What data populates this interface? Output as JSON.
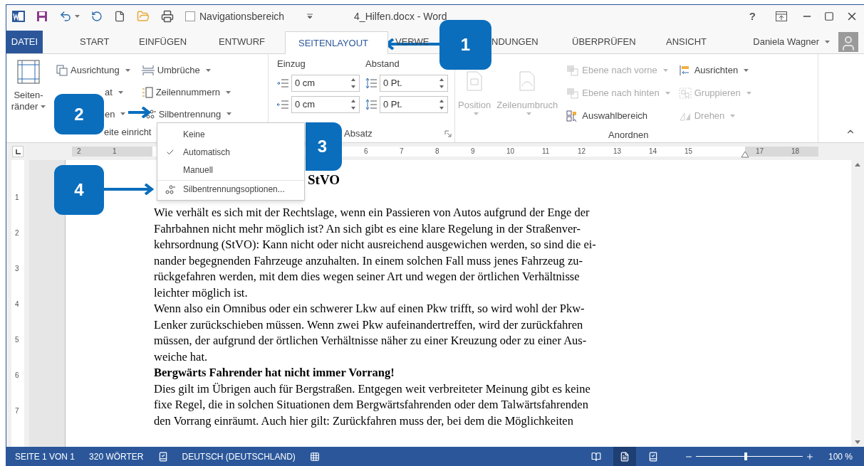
{
  "title_bar": {
    "nav_checkbox": {
      "label": "Navigationsbereich",
      "checked": false
    },
    "title": "4_Hilfen.docx - Word",
    "help": "?"
  },
  "tabs": [
    {
      "label": "DATEI",
      "kind": "file",
      "selected": false
    },
    {
      "label": "START",
      "kind": "tab",
      "selected": false
    },
    {
      "label": "EINFÜGEN",
      "kind": "tab",
      "selected": false
    },
    {
      "label": "ENTWURF",
      "kind": "tab",
      "selected": false
    },
    {
      "label": "SEITENLAYOUT",
      "kind": "tab",
      "selected": true
    },
    {
      "label": "VERWE",
      "kind": "tab",
      "selected": false
    },
    {
      "label": "NDUNGEN",
      "kind": "tab",
      "selected": false
    },
    {
      "label": "ÜBERPRÜFEN",
      "kind": "tab",
      "selected": false
    },
    {
      "label": "ANSICHT",
      "kind": "tab",
      "selected": false
    }
  ],
  "user": {
    "name": "Daniela Wagner"
  },
  "page_setup": {
    "label": "eite einricht",
    "margins": [
      "Seiten-",
      "ränder"
    ],
    "commands": [
      {
        "label": "Ausrichtung"
      },
      {
        "label": "at"
      },
      {
        "label": "en"
      },
      {
        "label": "Umbrüche"
      },
      {
        "label": "Zeilennummern"
      },
      {
        "label": "Silbentrennung"
      }
    ]
  },
  "paragraph": {
    "label": "Absatz",
    "indent": "Einzug",
    "spacing": "Abstand",
    "indent_fields": [
      {
        "value": "0 cm"
      },
      {
        "value": "0 cm"
      }
    ],
    "spacing_fields": [
      {
        "value": "0 Pt."
      },
      {
        "value": "0 Pt."
      }
    ]
  },
  "arrange": {
    "label": "Anordnen",
    "large": [
      {
        "label": "Position",
        "disabled": true
      },
      {
        "label": "Zeilenumbruch",
        "disabled": true
      }
    ],
    "commands": [
      {
        "label": "Ebene nach vorne",
        "disabled": true
      },
      {
        "label": "Ebene nach hinten",
        "disabled": true
      },
      {
        "label": "Auswahlbereich",
        "disabled": false
      },
      {
        "label": "Ausrichten",
        "disabled": false
      },
      {
        "label": "Gruppieren",
        "disabled": true
      },
      {
        "label": "Drehen",
        "disabled": true
      }
    ]
  },
  "ruler": {
    "numbers": [
      "2",
      "1",
      "6",
      "7",
      "8",
      "9",
      "10",
      "11",
      "12",
      "13",
      "14",
      "15",
      "17",
      "18"
    ],
    "vertical_numbers": [
      "1",
      "2",
      "3",
      "4",
      "5",
      "6",
      "7"
    ]
  },
  "hyphenation_menu": {
    "items": [
      {
        "label": "Keine",
        "kind": "choice",
        "checked": false
      },
      {
        "label": "Automatisch",
        "kind": "choice",
        "checked": true
      },
      {
        "label": "Manuell",
        "kind": "choice",
        "checked": false
      },
      {
        "label": "Silbentrennungsoptionen...",
        "kind": "dialog",
        "checked": false
      }
    ]
  },
  "document": {
    "heading_fragment": "StVO",
    "lines": [
      {
        "text": "Wie verhält es sich mit der Rechtslage, wenn ein Passieren von Autos aufgrund der Enge der",
        "kind": "normal"
      },
      {
        "text": "Fahrbahnen nicht mehr möglich ist? An sich gibt es eine klare Regelung in der Straßenver-",
        "kind": "normal"
      },
      {
        "text": "kehrsordnung (StVO): Kann nicht oder nicht ausreichend ausgewichen werden, so sind die ei-",
        "kind": "normal"
      },
      {
        "text": "nander begegnenden Fahrzeuge anzuhalten. In einem solchen Fall muss jenes Fahrzeug zu-",
        "kind": "normal"
      },
      {
        "text": "rückgefahren werden, mit dem dies wegen seiner Art und wegen der örtlichen Verhältnisse",
        "kind": "normal"
      },
      {
        "text": "leichter möglich ist.",
        "kind": "normal"
      },
      {
        "text": "Wenn also ein Omnibus oder ein schwerer Lkw auf einen Pkw trifft, so wird wohl der Pkw-",
        "kind": "normal"
      },
      {
        "text": "Lenker zurückschieben müssen. Wenn zwei Pkw aufeinandertreffen, wird der zurückfahren",
        "kind": "normal"
      },
      {
        "text": "müssen, der aufgrund der örtlichen Verhältnisse näher zu einer Kreuzung oder zu einer Aus-",
        "kind": "normal"
      },
      {
        "text": "weiche hat.",
        "kind": "normal"
      },
      {
        "text": "Bergwärts Fahrender hat nicht immer Vorrang!",
        "kind": "heading"
      },
      {
        "text": "Dies gilt im Übrigen auch für Bergstraßen. Entgegen weit verbreiteter Meinung gibt es keine",
        "kind": "normal"
      },
      {
        "text": "fixe Regel, die in solchen Situationen dem Bergwärtsfahrenden oder dem Talwärtsfahrenden",
        "kind": "normal"
      },
      {
        "text": "den Vorrang einräumt. Auch hier gilt: Zurückfahren muss der, bei dem die Möglichkeiten",
        "kind": "normal"
      }
    ]
  },
  "callouts": [
    {
      "number": "1"
    },
    {
      "number": "2"
    },
    {
      "number": "3"
    },
    {
      "number": "4"
    }
  ],
  "status_bar": {
    "page": "SEITE 1 VON 1",
    "words": "320 WÖRTER",
    "language": "DEUTSCH (DEUTSCHLAND)",
    "views": [
      {
        "selected": false
      },
      {
        "selected": true
      },
      {
        "selected": false
      }
    ],
    "zoom": {
      "level": 0.47
    },
    "zoom_label": "100 %"
  }
}
